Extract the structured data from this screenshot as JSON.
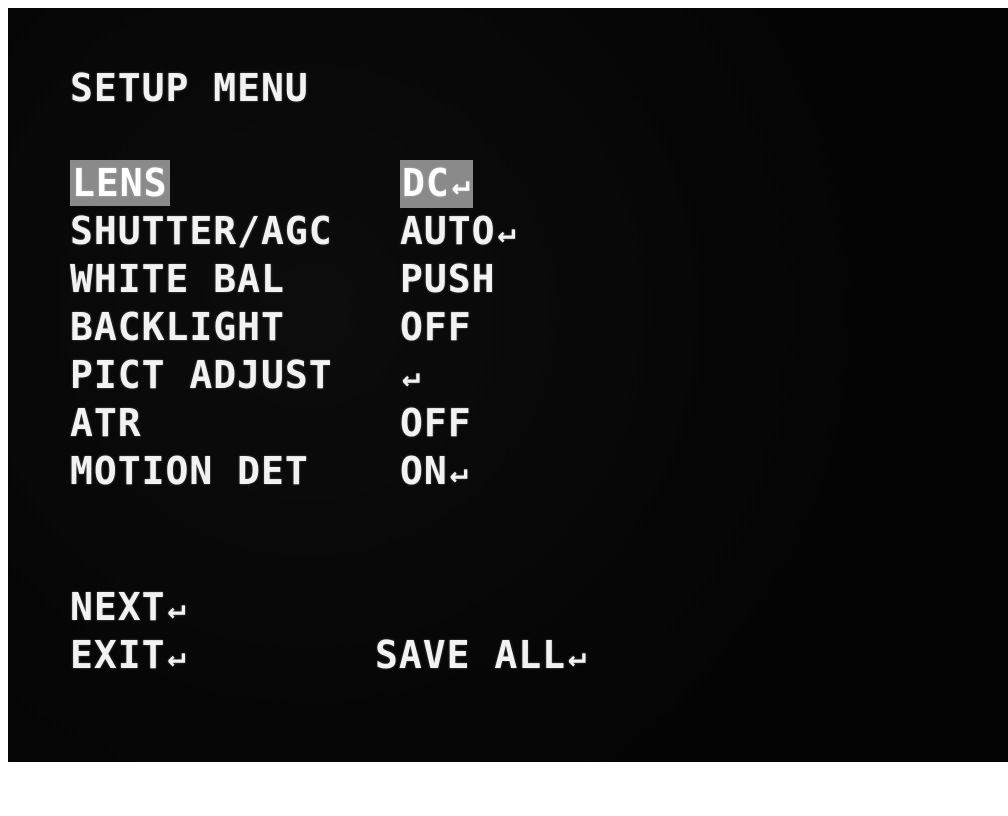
{
  "title": "SETUP MENU",
  "enter_glyph": "↵",
  "menu": [
    {
      "label": "LENS",
      "value": "DC",
      "enter": "↵",
      "selected": true
    },
    {
      "label": "SHUTTER/AGC",
      "value": "AUTO",
      "enter": "↵"
    },
    {
      "label": "WHITE BAL",
      "value": "PUSH",
      "enter": ""
    },
    {
      "label": "BACKLIGHT",
      "value": "OFF",
      "enter": ""
    },
    {
      "label": "PICT ADJUST",
      "value": "",
      "enter": "↵"
    },
    {
      "label": "ATR",
      "value": "OFF",
      "enter": ""
    },
    {
      "label": "MOTION DET",
      "value": "ON",
      "enter": "↵"
    }
  ],
  "bottom": {
    "next_label": "NEXT",
    "next_enter": "↵",
    "exit_label": "EXIT",
    "exit_enter": "↵",
    "save_label": "SAVE ALL",
    "save_enter": "↵"
  }
}
